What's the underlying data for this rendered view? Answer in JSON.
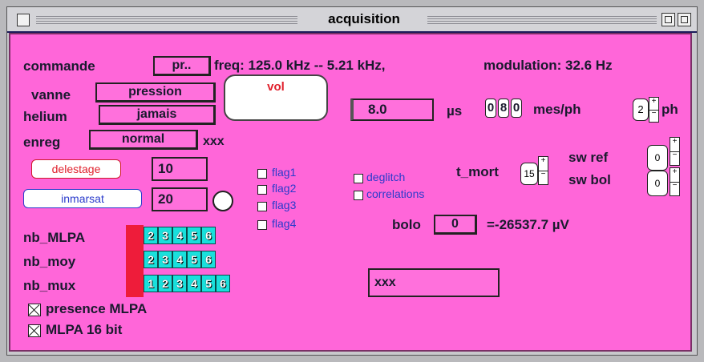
{
  "window": {
    "title": "acquisition"
  },
  "header": {
    "commande_label": "commande",
    "commande_value": "pr..",
    "freq_text": "freq: 125.0 kHz  --   5.21 kHz,",
    "modulation_text": "modulation: 32.6 Hz"
  },
  "left": {
    "vanne_label": "vanne",
    "vanne_value": "pression",
    "helium_label": "helium",
    "helium_value": "jamais",
    "enreg_label": "enreg",
    "enreg_value": "normal",
    "enreg_extra": "xxx",
    "delestage_label": "delestage",
    "delestage_value": "10",
    "inmarsat_label": "inmarsat",
    "inmarsat_value": "20"
  },
  "vol_button": "vol",
  "timing": {
    "value": "8.0",
    "unit": "µs"
  },
  "mesph": {
    "digits": [
      "0",
      "8",
      "0"
    ],
    "label": "mes/ph",
    "ph_value": "2",
    "ph_label": "ph"
  },
  "flags": [
    "flag1",
    "flag2",
    "flag3",
    "flag4"
  ],
  "options": [
    "deglitch",
    "correlations"
  ],
  "t_mort": {
    "label": "t_mort",
    "value": "15"
  },
  "sw": {
    "ref_label": "sw ref",
    "ref_value": "0",
    "bol_label": "sw bol",
    "bol_value": "0"
  },
  "bolo": {
    "label": "bolo",
    "value": "0",
    "reading": "=-26537.7 µV"
  },
  "bottom_box": "xxx",
  "selectors": {
    "nb_mlpa": {
      "label": "nb_MLPA",
      "options": [
        "2",
        "3",
        "4",
        "5",
        "6"
      ]
    },
    "nb_moy": {
      "label": "nb_moy",
      "options": [
        "2",
        "3",
        "4",
        "5",
        "6"
      ]
    },
    "nb_mux": {
      "label": "nb_mux",
      "options": [
        "1",
        "2",
        "3",
        "4",
        "5",
        "6"
      ]
    }
  },
  "checkboxes": {
    "presence": {
      "label": "presence MLPA",
      "checked": true
    },
    "bit16": {
      "label": "MLPA 16 bit",
      "checked": true
    }
  },
  "colors": {
    "panel": "#ff66d9",
    "cyan": "#19e0dc",
    "red_marker": "#ee1c3a",
    "text_red": "#e0202c",
    "text_blue": "#2a3bcb"
  }
}
